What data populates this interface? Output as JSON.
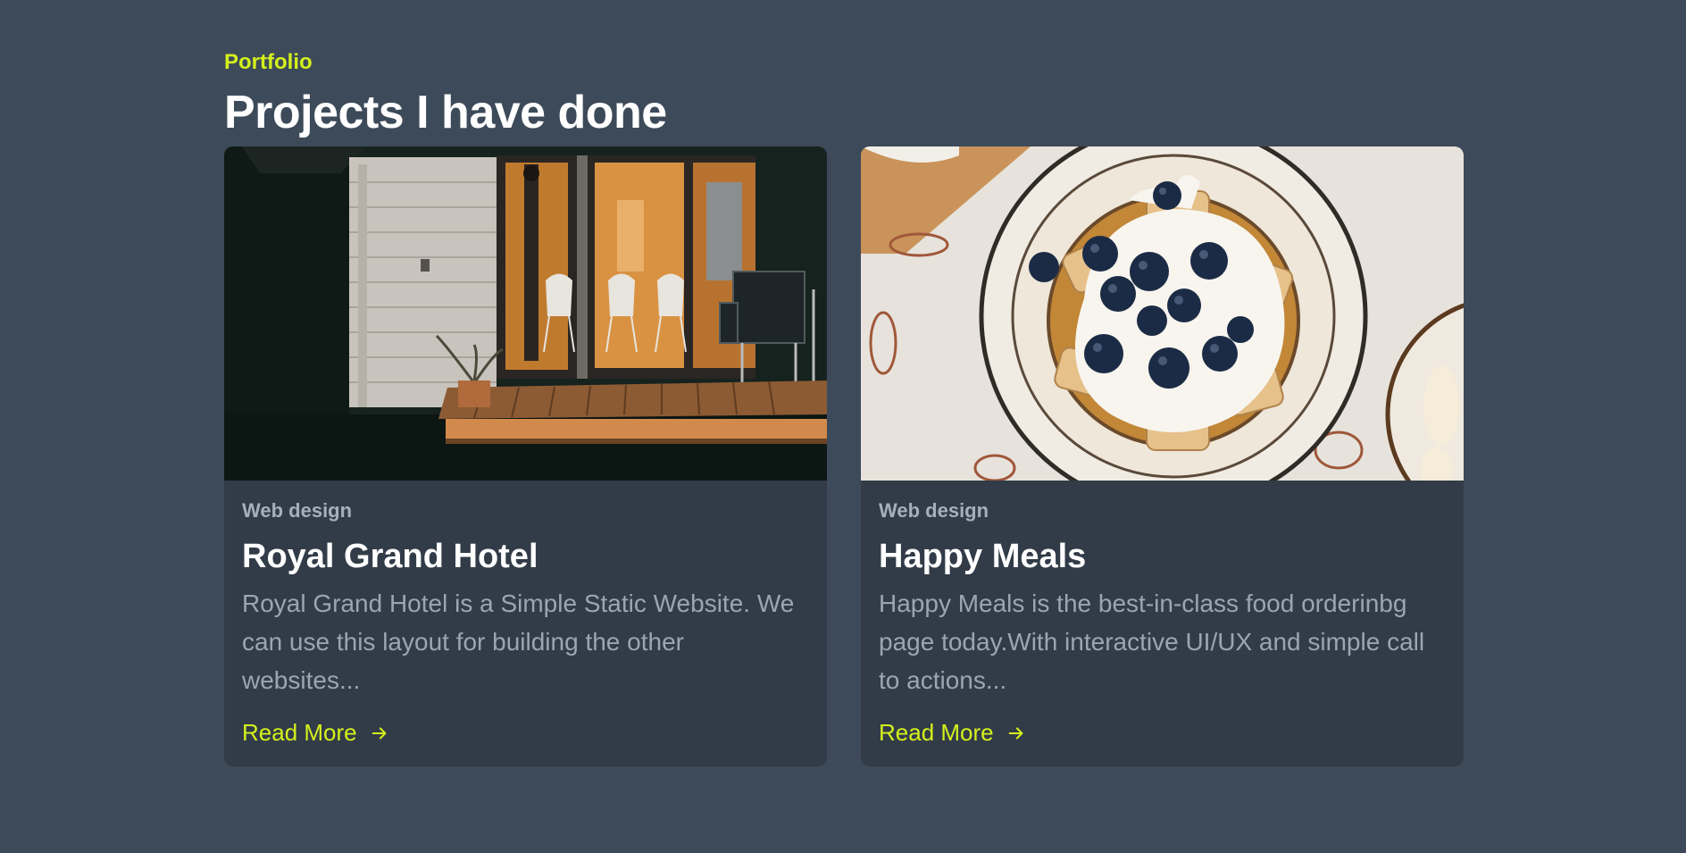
{
  "section": {
    "eyebrow": "Portfolio",
    "heading": "Projects I have done"
  },
  "projects": [
    {
      "image_alt": "Cabin porch at night with lit interior",
      "tag": "Web design",
      "title": "Royal Grand Hotel",
      "description": "Royal Grand Hotel is a Simple Static Website. We can use this layout for building the other websites...",
      "link_label": "Read More",
      "link_icon": "arrow-right-icon"
    },
    {
      "image_alt": "Waffles topped with cream and blueberries on a plate",
      "tag": "Web design",
      "title": "Happy Meals",
      "description": "Happy Meals is the best-in-class food orderinbg page today.With interactive UI/UX and simple call to actions...",
      "link_label": "Read More",
      "link_icon": "arrow-right-icon"
    }
  ],
  "colors": {
    "background": "#3d4a59",
    "card": "#323c48",
    "accent": "#d4f01c",
    "muted_text": "#9aa6b4"
  }
}
